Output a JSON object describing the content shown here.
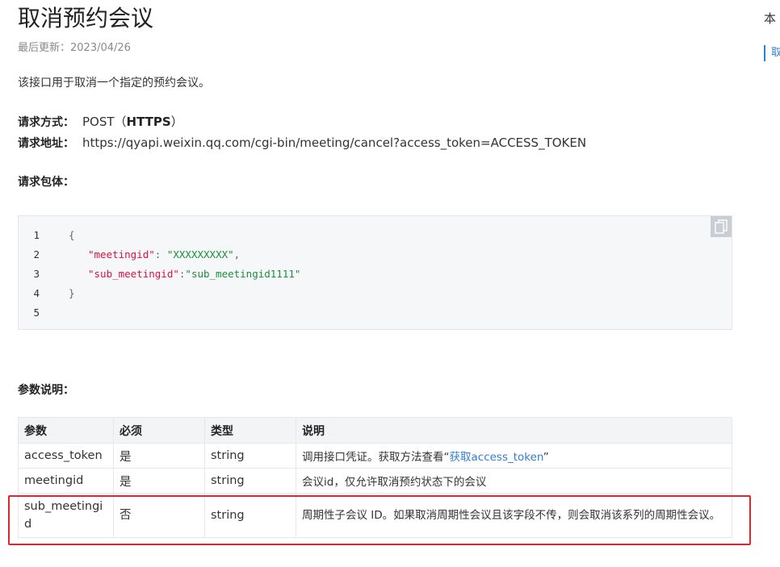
{
  "page": {
    "title": "取消预约会议",
    "updated": "最后更新：2023/04/26",
    "intro": "该接口用于取消一个指定的预约会议。"
  },
  "request": {
    "method_label": "请求方式：",
    "method_value": "POST（",
    "method_protocol": "HTTPS",
    "method_close": "）",
    "url_label": "请求地址：",
    "url_value": "https://qyapi.weixin.qq.com/cgi-bin/meeting/cancel?access_token=ACCESS_TOKEN",
    "body_label": "请求包体："
  },
  "code": {
    "lines": [
      {
        "num": "1",
        "open": "{"
      },
      {
        "num": "2",
        "key": "\"meetingid\"",
        "sep": ": ",
        "value": "\"XXXXXXXXX\"",
        "tail": ","
      },
      {
        "num": "3",
        "key": "\"sub_meetingid\"",
        "sep": ":",
        "value": "\"sub_meetingid1111\"",
        "tail": ""
      },
      {
        "num": "4",
        "open": "}"
      },
      {
        "num": "5",
        "open": ""
      }
    ]
  },
  "params": {
    "section_label": "参数说明：",
    "headers": [
      "参数",
      "必须",
      "类型",
      "说明"
    ],
    "rows": [
      {
        "name": "access_token",
        "required": "是",
        "type": "string",
        "desc_pre": "调用接口凭证。获取方法查看“",
        "desc_link": "获取access_token",
        "desc_post": "”"
      },
      {
        "name": "meetingid",
        "required": "是",
        "type": "string",
        "desc_pre": "会议id，仅允许取消预约状态下的会议",
        "desc_link": "",
        "desc_post": ""
      },
      {
        "name": "sub_meetingid",
        "required": "否",
        "type": "string",
        "desc_pre": "周期性子会议 ID。如果取消周期性会议且该字段不传，则会取消该系列的周期性会议。",
        "desc_link": "",
        "desc_post": ""
      }
    ]
  },
  "sidebar": {
    "heading_cut": "本",
    "link_cut": "取"
  },
  "colors": {
    "link": "#2f7fd3",
    "highlight_border": "#d9282f",
    "code_key": "#d14",
    "code_string": "#1a8f3a"
  }
}
